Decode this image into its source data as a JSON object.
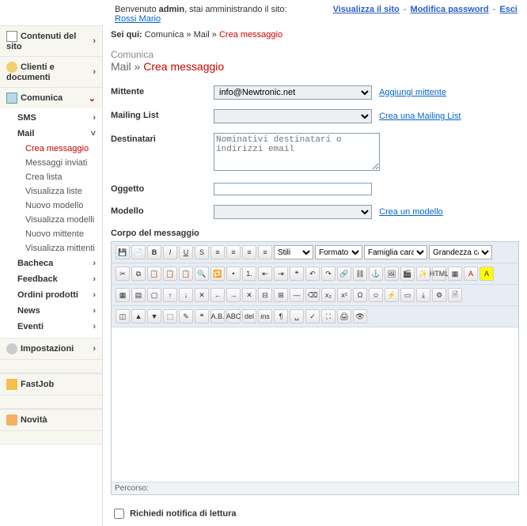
{
  "topbar": {
    "welcome_prefix": "Benvenuto ",
    "welcome_user": "admin",
    "welcome_suffix": ", stai amministrando il sito:",
    "site_name": "Rossi Mario",
    "view_site": "Visualizza il sito",
    "change_pwd": "Modifica password",
    "logout": "Esci"
  },
  "sidebar": {
    "contents": "Contenuti del sito",
    "clients": "Clienti e documenti",
    "comunica": "Comunica",
    "sms": "SMS",
    "mail": "Mail",
    "crea_messaggio": "Crea messaggio",
    "msg_inviati": "Messaggi inviati",
    "crea_lista": "Crea lista",
    "vis_liste": "Visualizza liste",
    "nuovo_modello": "Nuovo modello",
    "vis_modelli": "Visualizza modelli",
    "nuovo_mittente": "Nuovo mittente",
    "vis_mittenti": "Visualizza mittenti",
    "bacheca": "Bacheca",
    "feedback": "Feedback",
    "ordini": "Ordini prodotti",
    "news": "News",
    "eventi": "Eventi",
    "settings": "Impostazioni",
    "fastjob": "FastJob",
    "novita": "Novità"
  },
  "breadcrumb": {
    "prefix": "Sei qui:",
    "l1": "Comunica",
    "l2": "Mail",
    "l3": "Crea messaggio"
  },
  "head": {
    "section": "Comunica",
    "sub1": "Mail",
    "sub2": "Crea messaggio"
  },
  "form": {
    "mittente_label": "Mittente",
    "mittente_value": "info@Newtronic.net",
    "mittente_link": "Aggiungi mittente",
    "mlist_label": "Mailing List",
    "mlist_link": "Crea una Mailing List",
    "dest_label": "Destinatari",
    "dest_placeholder": "Nominativi destinatari o indirizzi email",
    "oggetto_label": "Oggetto",
    "modello_label": "Modello",
    "modello_link": "Crea un modello",
    "corpo_label": "Corpo del messaggio",
    "percorso": "Percorso:",
    "notifica": "Richiedi notifica di lettura"
  },
  "toolbar_selects": {
    "stili": "Stili",
    "formato": "Formato",
    "font": "Famiglia caratt",
    "size": "Grandezza car"
  }
}
